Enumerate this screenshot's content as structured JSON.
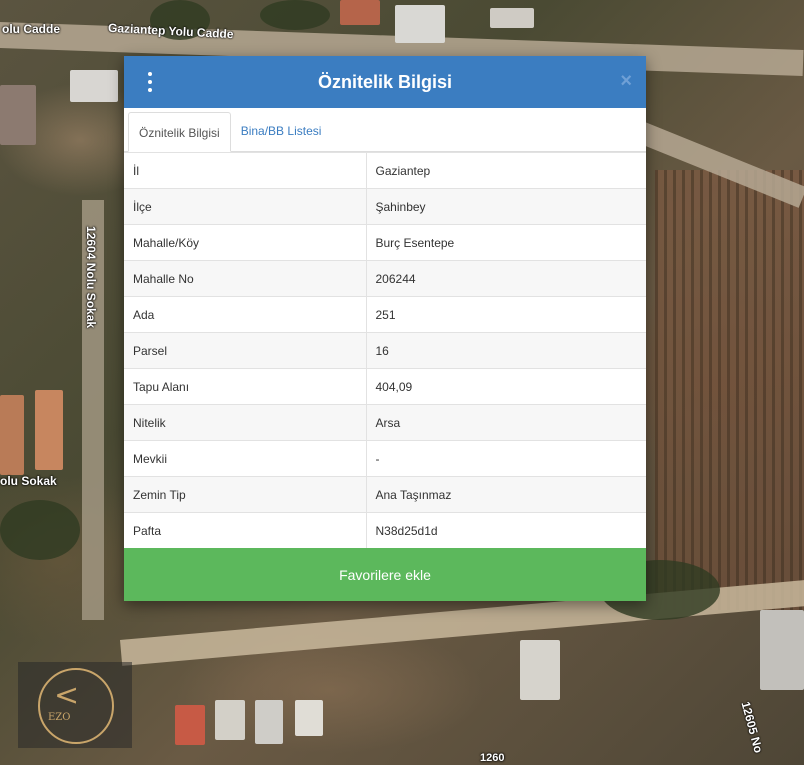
{
  "map": {
    "street_labels": [
      "olu Cadde",
      "Gaziantep Yolu Cadde",
      "12604 Nolu Sokak",
      "olu Sokak",
      "12605 No",
      "1260"
    ]
  },
  "logo": {
    "text": "EZO"
  },
  "dialog": {
    "title": "Öznitelik Bilgisi",
    "close_symbol": "×",
    "tabs": [
      {
        "label": "Öznitelik Bilgisi",
        "active": true
      },
      {
        "label": "Bina/BB Listesi",
        "active": false
      }
    ],
    "rows": [
      {
        "key": "İl",
        "value": "Gaziantep"
      },
      {
        "key": "İlçe",
        "value": "Şahinbey"
      },
      {
        "key": "Mahalle/Köy",
        "value": "Burç Esentepe"
      },
      {
        "key": "Mahalle No",
        "value": "206244"
      },
      {
        "key": "Ada",
        "value": "251"
      },
      {
        "key": "Parsel",
        "value": "16"
      },
      {
        "key": "Tapu Alanı",
        "value": "404,09"
      },
      {
        "key": "Nitelik",
        "value": "Arsa"
      },
      {
        "key": "Mevkii",
        "value": "-"
      },
      {
        "key": "Zemin Tip",
        "value": "Ana Taşınmaz"
      },
      {
        "key": "Pafta",
        "value": "N38d25d1d"
      }
    ],
    "favorite_button": "Favorilere ekle"
  },
  "colors": {
    "header": "#3b7dc1",
    "tab_link": "#3b7dc1",
    "favorite_button": "#5cb85c"
  },
  "icons": [
    "menu-vertical-dots-icon",
    "close-icon"
  ]
}
